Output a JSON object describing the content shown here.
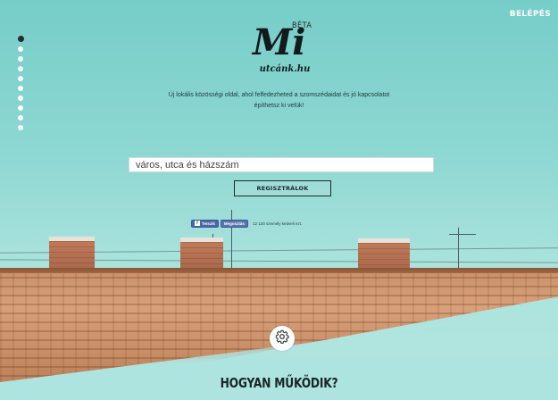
{
  "header": {
    "login_label": "BELÉPÉS"
  },
  "logo": {
    "beta": "BÉTA",
    "mi": "Mi",
    "domain": "utcánk.hu"
  },
  "tagline": "Új lokális közösségi oldal, ahol felfedezheted a szomszédaidat és jó kapcsolatot építhetsz ki velük!",
  "search": {
    "placeholder": "város, utca és házszám"
  },
  "register_label": "REGISZTRÁLOK",
  "social": {
    "like_label": "Tetszik",
    "share_label": "Megosztás",
    "count_text": "12 120 személy kedveli ezt."
  },
  "section_title": "HOGYAN MŰKÖDIK?",
  "icons": {
    "settings": "gear-icon",
    "facebook": "facebook-icon"
  },
  "colors": {
    "sky": "#76cdc8",
    "text_dark": "#1a2628",
    "facebook": "#3b5998"
  },
  "nav_dots": {
    "count": 10,
    "active_index": 0
  }
}
